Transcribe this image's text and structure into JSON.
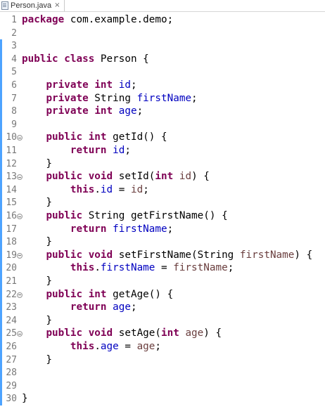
{
  "tab": {
    "label": "Person.java",
    "close": "×"
  },
  "lines": [
    {
      "n": "1",
      "code": "package com.example.demo;"
    },
    {
      "n": "2",
      "code": ""
    },
    {
      "n": "3",
      "code": ""
    },
    {
      "n": "4",
      "code": "public class Person {"
    },
    {
      "n": "5",
      "code": ""
    },
    {
      "n": "6",
      "code": "    private int id;"
    },
    {
      "n": "7",
      "code": "    private String firstName;"
    },
    {
      "n": "8",
      "code": "    private int age;"
    },
    {
      "n": "9",
      "code": ""
    },
    {
      "n": "10",
      "code": "    public int getId() {"
    },
    {
      "n": "11",
      "code": "        return id;"
    },
    {
      "n": "12",
      "code": "    }"
    },
    {
      "n": "13",
      "code": "    public void setId(int id) {"
    },
    {
      "n": "14",
      "code": "        this.id = id;"
    },
    {
      "n": "15",
      "code": "    }"
    },
    {
      "n": "16",
      "code": "    public String getFirstName() {"
    },
    {
      "n": "17",
      "code": "        return firstName;"
    },
    {
      "n": "18",
      "code": "    }"
    },
    {
      "n": "19",
      "code": "    public void setFirstName(String firstName) {"
    },
    {
      "n": "20",
      "code": "        this.firstName = firstName;"
    },
    {
      "n": "21",
      "code": "    }"
    },
    {
      "n": "22",
      "code": "    public int getAge() {"
    },
    {
      "n": "23",
      "code": "        return age;"
    },
    {
      "n": "24",
      "code": "    }"
    },
    {
      "n": "25",
      "code": "    public void setAge(int age) {"
    },
    {
      "n": "26",
      "code": "        this.age = age;"
    },
    {
      "n": "27",
      "code": "    }"
    },
    {
      "n": "28",
      "code": ""
    },
    {
      "n": "29",
      "code": ""
    },
    {
      "n": "30",
      "code": "}"
    }
  ],
  "fold_lines": [
    "10",
    "13",
    "16",
    "19",
    "22",
    "25"
  ],
  "colors": {
    "keyword": "#7f0055",
    "field": "#0000c0",
    "parameter": "#6a3e3e",
    "line_number": "#787878",
    "change_marker": "#4da3ff"
  }
}
